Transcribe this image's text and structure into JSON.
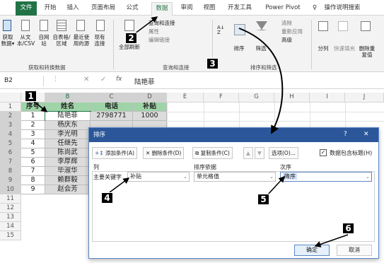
{
  "tabs": [
    "文件",
    "开始",
    "插入",
    "页面布局",
    "公式",
    "数据",
    "审阅",
    "视图",
    "开发工具",
    "Power Pivot",
    "操作说明搜索"
  ],
  "ribbon": {
    "get_data": "获取数据▾",
    "from_text": "从文本/CSV",
    "from_web": "自网站",
    "from_table": "自表格/区域",
    "recent": "最近使用的源",
    "existing": "现有连接",
    "group1": "获取和转换数据",
    "refresh": "全部刷新",
    "queries": "查询和连接",
    "properties": "属性",
    "edit_links": "编辑链接",
    "group2": "查询和连接",
    "sort": "排序",
    "filter": "筛选",
    "clear": "清除",
    "reapply": "重新应用",
    "advanced": "高级",
    "group3": "排序和筛选",
    "split": "分列",
    "flash": "快速填充",
    "remove_dup": "删除重复值"
  },
  "formula_bar": {
    "name_box": "B2",
    "fx": "fx",
    "value": "陆艳菲"
  },
  "columns": [
    "A",
    "B",
    "C",
    "D",
    "E",
    "F",
    "G",
    "H",
    "I",
    "J"
  ],
  "rows": [
    "1",
    "2",
    "3",
    "4",
    "5",
    "6",
    "7",
    "8",
    "9",
    "10",
    "11",
    "12",
    "13",
    "14",
    "15"
  ],
  "table": {
    "headers": [
      "序号",
      "姓名",
      "电话",
      "补贴"
    ],
    "data": [
      [
        "1",
        "陆艳菲",
        "2798771",
        "1000"
      ],
      [
        "2",
        "杨庆东",
        "",
        ""
      ],
      [
        "3",
        "李光明",
        "",
        ""
      ],
      [
        "4",
        "任继先",
        "",
        ""
      ],
      [
        "5",
        "陈尚武",
        "",
        ""
      ],
      [
        "6",
        "李厚辉",
        "",
        ""
      ],
      [
        "7",
        "毕淑华",
        "",
        ""
      ],
      [
        "8",
        "赖群毅",
        "",
        ""
      ],
      [
        "9",
        "赵会芳",
        "",
        ""
      ]
    ]
  },
  "dialog": {
    "title": "排序",
    "help": "?",
    "close": "✕",
    "add": "添加条件(A)",
    "delete": "删除条件(D)",
    "copy": "复制条件(C)",
    "options": "选项(O)...",
    "has_header": "数据包含标题(H)",
    "col_header": "列",
    "basis_header": "排序依据",
    "order_header": "次序",
    "main_key": "主要关键字",
    "key_value": "补贴",
    "basis_value": "单元格值",
    "order_value": "降序",
    "ok": "确定",
    "cancel": "取消"
  },
  "callouts": [
    "1",
    "2",
    "3",
    "4",
    "5",
    "6"
  ]
}
